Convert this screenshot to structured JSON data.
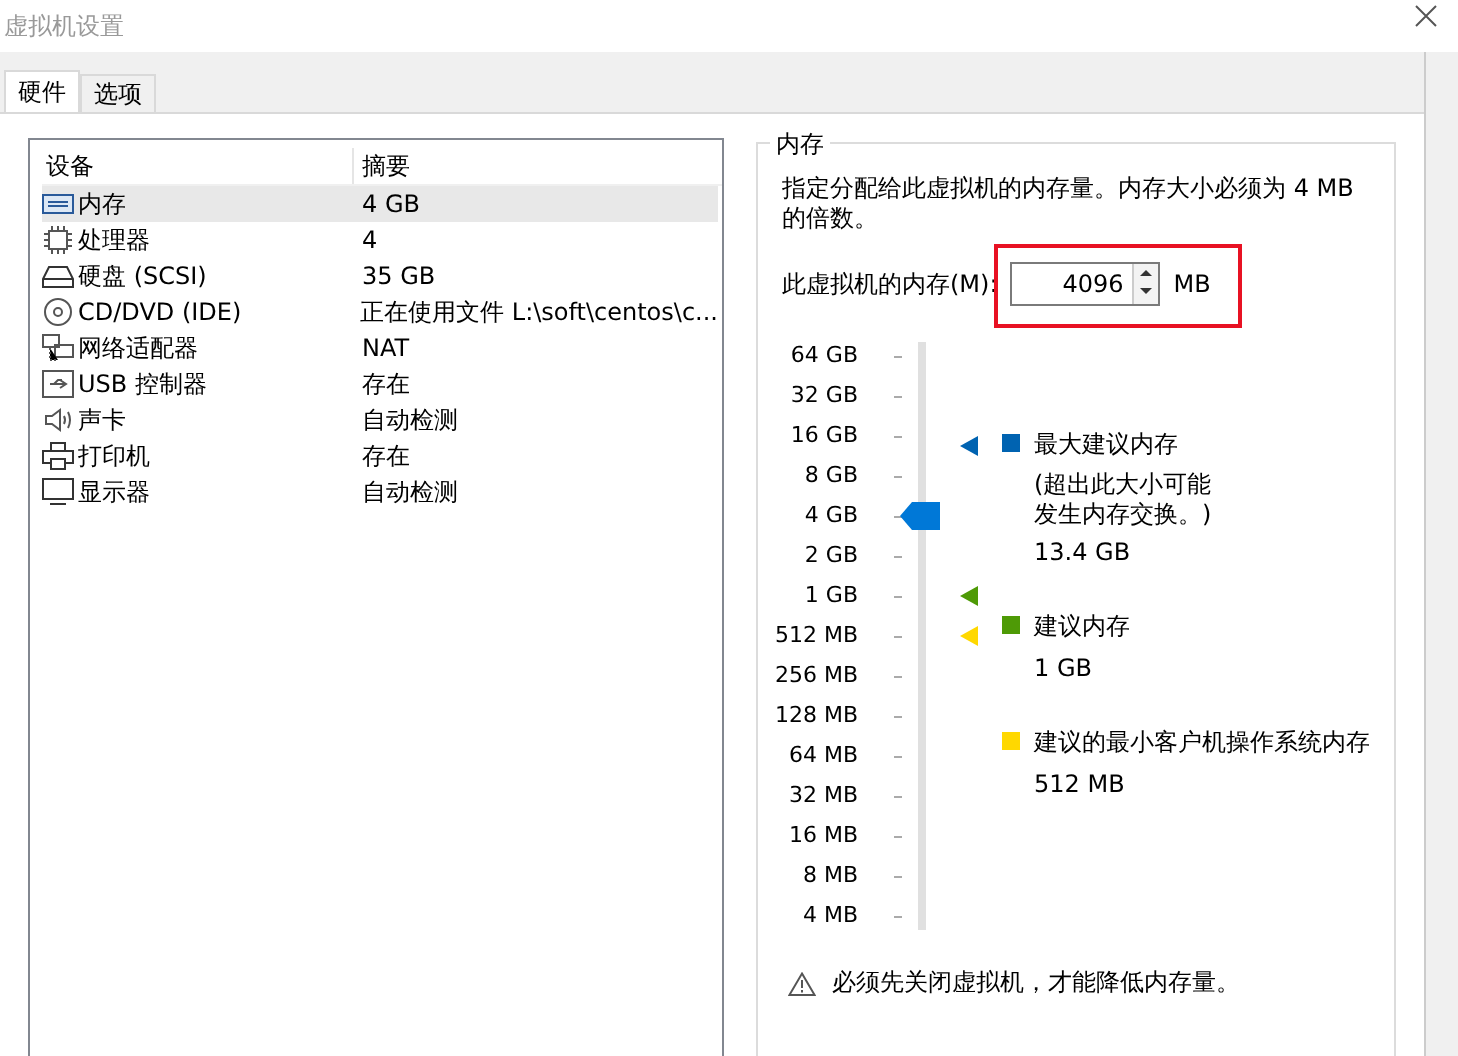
{
  "window": {
    "title": "虚拟机设置"
  },
  "tabs": [
    {
      "label": "硬件",
      "selected": true
    },
    {
      "label": "选项",
      "selected": false
    }
  ],
  "devices": {
    "columns": [
      "设备",
      "摘要"
    ],
    "rows": [
      {
        "kind": "memory",
        "name": "内存",
        "summary": "4 GB",
        "selected": true
      },
      {
        "kind": "cpu",
        "name": "处理器",
        "summary": "4",
        "selected": false
      },
      {
        "kind": "disk",
        "name": "硬盘 (SCSI)",
        "summary": "35 GB",
        "selected": false
      },
      {
        "kind": "cd",
        "name": "CD/DVD (IDE)",
        "summary": "正在使用文件 L:\\soft\\centos\\c...",
        "selected": false
      },
      {
        "kind": "network",
        "name": "网络适配器",
        "summary": "NAT",
        "selected": false
      },
      {
        "kind": "usb",
        "name": "USB 控制器",
        "summary": "存在",
        "selected": false
      },
      {
        "kind": "sound",
        "name": "声卡",
        "summary": "自动检测",
        "selected": false
      },
      {
        "kind": "printer",
        "name": "打印机",
        "summary": "存在",
        "selected": false
      },
      {
        "kind": "display",
        "name": "显示器",
        "summary": "自动检测",
        "selected": false
      }
    ]
  },
  "memory": {
    "title": "内存",
    "description": "指定分配给此虚拟机的内存量。内存大小必须为 4 MB 的倍数。",
    "field_label": "此虚拟机的内存(M):",
    "value": "4096",
    "unit": "MB",
    "scale": [
      "64 GB",
      "32 GB",
      "16 GB",
      "8 GB",
      "4 GB",
      "2 GB",
      "1 GB",
      "512 MB",
      "256 MB",
      "128 MB",
      "64 MB",
      "32 MB",
      "16 MB",
      "8 MB",
      "4 MB"
    ],
    "level": 0.714,
    "markers": [
      {
        "level": 0.84
      },
      {
        "level": 0.571
      },
      {
        "level": 0.5
      }
    ],
    "legend": [
      {
        "label": "最大建议内存",
        "note": "(超出此大小可能发生内存交换。)",
        "value": "13.4 GB",
        "color": "#0063b1"
      },
      {
        "label": "建议内存",
        "value": "1 GB",
        "color": "#4e9a06"
      },
      {
        "label": "建议的最小客户机操作系统内存",
        "value": "512 MB",
        "color": "#ffd800"
      }
    ],
    "warning": "必须先关闭虚拟机，才能降低内存量。"
  }
}
